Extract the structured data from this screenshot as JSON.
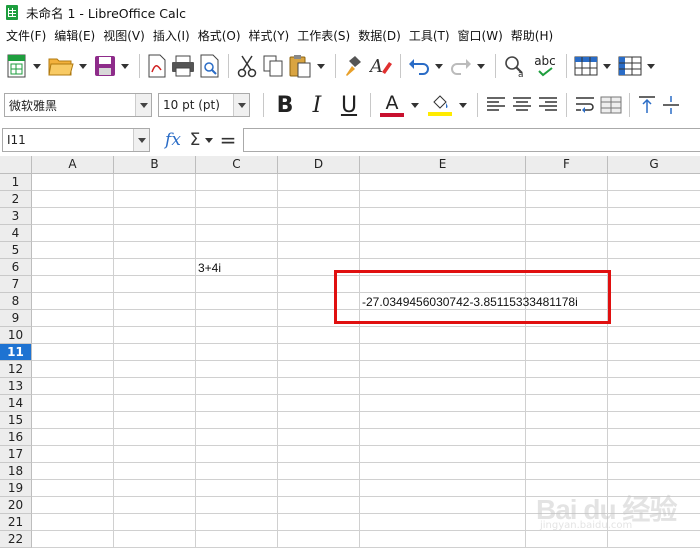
{
  "window": {
    "title": "未命名 1 - LibreOffice Calc"
  },
  "menu": [
    "文件(F)",
    "编辑(E)",
    "视图(V)",
    "插入(I)",
    "格式(O)",
    "样式(Y)",
    "工作表(S)",
    "数据(D)",
    "工具(T)",
    "窗口(W)",
    "帮助(H)"
  ],
  "toolbar": {
    "icons": [
      "new-icon",
      "open-icon",
      "save-icon",
      "export-pdf-icon",
      "print-icon",
      "print-preview-icon",
      "cut-icon",
      "copy-icon",
      "paste-icon",
      "clone-formatting-icon",
      "clear-formatting-icon",
      "undo-icon",
      "redo-icon",
      "find-replace-icon",
      "spelling-icon",
      "row-icon",
      "column-icon"
    ],
    "spelling_label": "abc"
  },
  "format_bar": {
    "font_name": "微软雅黑",
    "font_size": "10 pt (pt)",
    "bold": "B",
    "italic": "I",
    "underline": "U",
    "font_color_letter": "A",
    "font_color": "#c8102e",
    "highlight_color": "#ffeb00"
  },
  "formula_bar": {
    "name_box": "I11",
    "fx": "fx",
    "sigma": "Σ",
    "equals": "=",
    "formula": ""
  },
  "sheet": {
    "columns": [
      "A",
      "B",
      "C",
      "D",
      "E",
      "F",
      "G"
    ],
    "rows": [
      "1",
      "2",
      "3",
      "4",
      "5",
      "6",
      "7",
      "8",
      "9",
      "10",
      "11",
      "12",
      "13",
      "14",
      "15",
      "16",
      "17",
      "18",
      "19",
      "20",
      "21",
      "22"
    ],
    "active_row": "11",
    "cells": {
      "C6": "3+4i",
      "E8": "-27.0349456030742-3.85115333481178i"
    }
  },
  "watermark": {
    "main": "Bai du 经验",
    "sub": "jingyan.baidu.com"
  },
  "colors": {
    "accent_blue": "#1e73d2",
    "highlight_red": "#e01010",
    "calc_green": "#1e9e3e"
  }
}
